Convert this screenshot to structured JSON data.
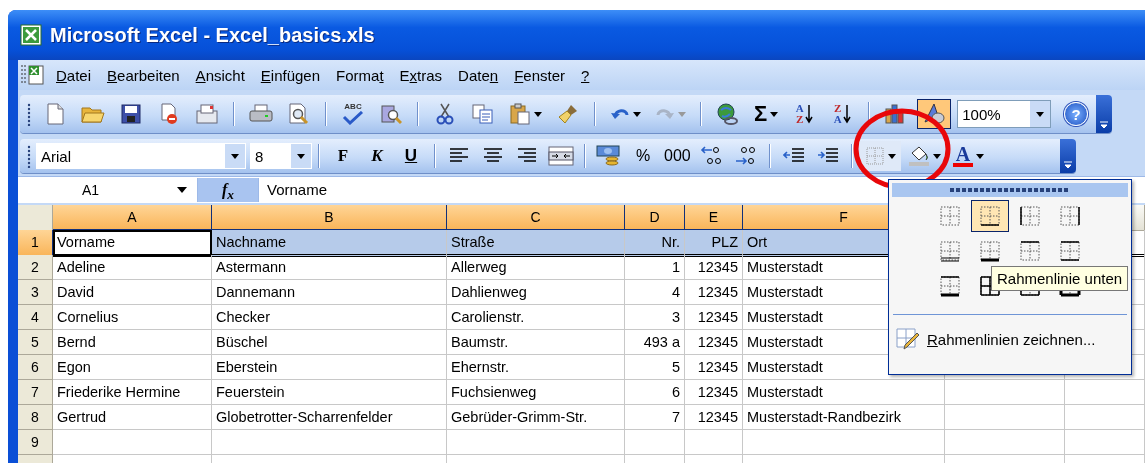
{
  "window": {
    "title": "Microsoft Excel - Excel_basics.xls"
  },
  "menu": [
    {
      "key": "D",
      "rest": "atei"
    },
    {
      "key": "B",
      "rest": "earbeiten"
    },
    {
      "key": "A",
      "rest": "nsicht"
    },
    {
      "key": "E",
      "rest": "infügen"
    },
    {
      "prefix": "Forma",
      "key": "t"
    },
    {
      "prefix": "E",
      "key": "x",
      "rest": "tras"
    },
    {
      "prefix": "Date",
      "key": "n"
    },
    {
      "key": "F",
      "rest": "enster"
    },
    {
      "key": "?"
    }
  ],
  "standard_toolbar": {
    "spelling_label": "ABC",
    "sum": "Σ",
    "sort_ascending": {
      "top": "A",
      "bottom": "Z"
    },
    "sort_descending": {
      "top": "Z",
      "bottom": "A"
    },
    "drawing_pressed": true,
    "zoom": "100%",
    "help": "?"
  },
  "formatting_toolbar": {
    "font": "Arial",
    "size": "8",
    "bold": "F",
    "italic": "K",
    "underline": "U",
    "percent": "%",
    "thousands": "000",
    "font_color_label": "A"
  },
  "formula_bar": {
    "name_box": "A1",
    "function_label": "f$_{x}$",
    "formula": "Vorname"
  },
  "sheet": {
    "columns": [
      {
        "label": "A",
        "selected": true,
        "active": true,
        "kind": "text"
      },
      {
        "label": "B",
        "selected": true,
        "active": false,
        "kind": "text"
      },
      {
        "label": "C",
        "selected": true,
        "active": false,
        "kind": "text"
      },
      {
        "label": "D",
        "selected": true,
        "active": false,
        "kind": "number"
      },
      {
        "label": "E",
        "selected": true,
        "active": false,
        "kind": "number"
      },
      {
        "label": "F",
        "selected": true,
        "active": false,
        "kind": "text"
      }
    ],
    "rows": [
      {
        "header": "1",
        "selected": true,
        "active": true,
        "cells": [
          "Vorname",
          "Nachname",
          "Straße",
          "Nr.",
          "PLZ",
          "Ort"
        ]
      },
      {
        "header": "2",
        "selected": false,
        "active": false,
        "cells": [
          "Adeline",
          "Astermann",
          "Allerweg",
          "1",
          "12345",
          "Musterstadt"
        ]
      },
      {
        "header": "3",
        "selected": false,
        "active": false,
        "cells": [
          "David",
          "Dannemann",
          "Dahlienweg",
          "4",
          "12345",
          "Musterstadt"
        ]
      },
      {
        "header": "4",
        "selected": false,
        "active": false,
        "cells": [
          "Cornelius",
          "Checker",
          "Carolienstr.",
          "3",
          "12345",
          "Musterstadt"
        ]
      },
      {
        "header": "5",
        "selected": false,
        "active": false,
        "cells": [
          "Bernd",
          "Büschel",
          "Baumstr.",
          "493 a",
          "12345",
          "Musterstadt"
        ]
      },
      {
        "header": "6",
        "selected": false,
        "active": false,
        "cells": [
          "Egon",
          "Eberstein",
          "Ehernstr.",
          "5",
          "12345",
          "Musterstadt"
        ]
      },
      {
        "header": "7",
        "selected": false,
        "active": false,
        "cells": [
          "Friederike Hermine",
          "Feuerstein",
          "Fuchsienweg",
          "6",
          "12345",
          "Musterstadt"
        ]
      },
      {
        "header": "8",
        "selected": false,
        "active": false,
        "cells": [
          "Gertrud",
          "Globetrotter-Scharrenfelder",
          "Gebrüder-Grimm-Str.",
          "7",
          "12345",
          "Musterstadt-Randbezirk"
        ]
      },
      {
        "header": "9",
        "selected": false,
        "active": false,
        "cells": []
      }
    ]
  },
  "borders_menu": {
    "options": [
      {
        "kind": "none",
        "selected": false
      },
      {
        "kind": "bottom",
        "selected": true
      },
      {
        "kind": "left",
        "selected": false
      },
      {
        "kind": "right",
        "selected": false
      },
      {
        "kind": "bottom-double",
        "selected": false
      },
      {
        "kind": "bottom-thick",
        "selected": false
      },
      {
        "kind": "top",
        "selected": false
      },
      {
        "kind": "top-bottom",
        "selected": false
      },
      {
        "kind": "top-bottom-thick",
        "selected": false
      },
      {
        "kind": "all",
        "selected": false
      },
      {
        "kind": "outside",
        "selected": false
      },
      {
        "kind": "thick-outside",
        "selected": false
      }
    ],
    "tooltip": "Rahmenlinie unten",
    "draw_item": {
      "key": "R",
      "rest": "ahmenlinien zeichnen..."
    }
  }
}
